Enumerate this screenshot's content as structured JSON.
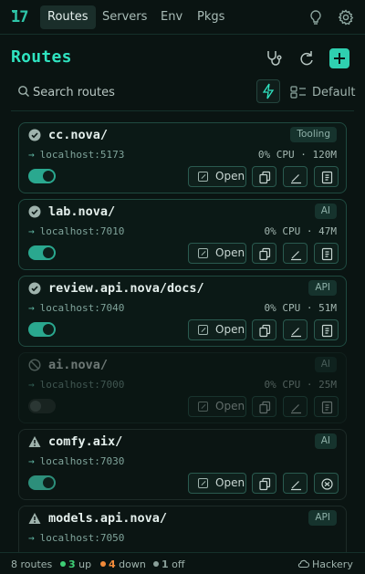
{
  "nav": {
    "logo": "17",
    "tabs": [
      {
        "label": "Routes",
        "active": true
      },
      {
        "label": "Servers",
        "active": false
      },
      {
        "label": "Env",
        "active": false
      },
      {
        "label": "Pkgs",
        "active": false
      }
    ]
  },
  "header": {
    "title": "Routes"
  },
  "search": {
    "placeholder": "Search routes",
    "sort_label": "Default"
  },
  "routes": [
    {
      "name": "cc.nova/",
      "tag": "Tooling",
      "target": "localhost:5173",
      "cpu": "0% CPU · 120M",
      "status": "up",
      "enabled": true,
      "open_label": "Open"
    },
    {
      "name": "lab.nova/",
      "tag": "AI",
      "target": "localhost:7010",
      "cpu": "0% CPU · 47M",
      "status": "up",
      "enabled": true,
      "open_label": "Open"
    },
    {
      "name": "review.api.nova/docs/",
      "tag": "API",
      "target": "localhost:7040",
      "cpu": "0% CPU · 51M",
      "status": "up",
      "enabled": true,
      "open_label": "Open"
    },
    {
      "name": "ai.nova/",
      "tag": "AI",
      "target": "localhost:7000",
      "cpu": "0% CPU · 25M",
      "status": "off",
      "enabled": false,
      "open_label": "Open"
    },
    {
      "name": "comfy.aix/",
      "tag": "AI",
      "target": "localhost:7030",
      "cpu": "",
      "status": "down",
      "enabled": true,
      "open_label": "Open"
    },
    {
      "name": "models.api.nova/",
      "tag": "API",
      "target": "localhost:7050",
      "cpu": "",
      "status": "down",
      "enabled": true,
      "open_label": "Open"
    }
  ],
  "footer": {
    "routes_count": "8 routes",
    "up": "3",
    "up_label": "up",
    "down": "4",
    "down_label": "down",
    "off": "1",
    "off_label": "off",
    "user": "Hackery"
  },
  "colors": {
    "accent": "#2fe3c0",
    "up": "#3ecf75",
    "down": "#f08a3a",
    "off": "#8aa09a"
  }
}
